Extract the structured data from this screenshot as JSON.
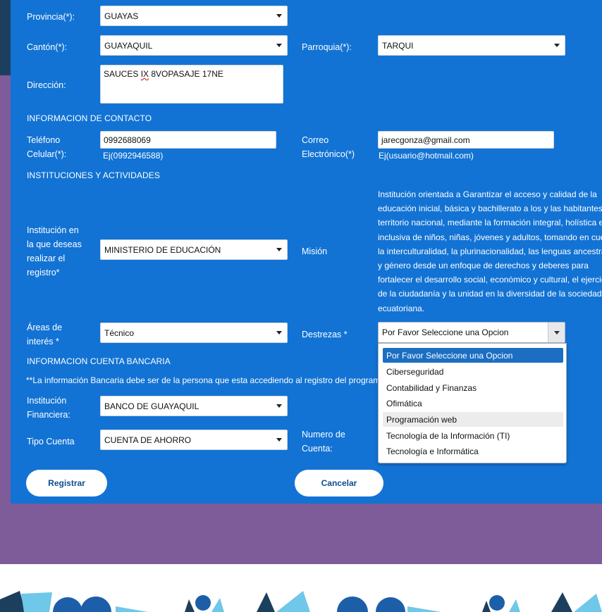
{
  "location": {
    "provincia_label": "Provincia(*):",
    "provincia_value": "GUAYAS",
    "canton_label": "Cantón(*):",
    "canton_value": "GUAYAQUIL",
    "parroquia_label": "Parroquia(*):",
    "parroquia_value": "TARQUI",
    "direccion_label": "Dirección:",
    "direccion_prefix": "SAUCES ",
    "direccion_misspelled": "IX",
    "direccion_suffix": " 8VOPASAJE 17NE"
  },
  "contact": {
    "section_title": "INFORMACION DE CONTACTO",
    "telefono_label_line1": "Teléfono",
    "telefono_label_line2": "Celular(*):",
    "telefono_value": "0992688069",
    "telefono_hint": "Ej(0992946588)",
    "correo_label_line1": "Correo",
    "correo_label_line2": "Electrónico(*)",
    "correo_value": "jarecgonza@gmail.com",
    "correo_hint": "Ej(usuario@hotmail.com)"
  },
  "institutions": {
    "section_title": "INSTITUCIONES Y ACTIVIDADES",
    "institucion_label_lines": [
      "Institución en",
      "la que deseas",
      "realizar el",
      "registro*"
    ],
    "institucion_value": "MINISTERIO DE EDUCACIÓN",
    "mision_label": "Misión",
    "mision_lines": [
      "Institución orientada a Garantizar el acceso y calidad de la",
      "educación inicial, básica y bachillerato a los y las habitantes del",
      "territorio nacional, mediante la formación integral, holística e",
      "inclusiva de niños, niñas, jóvenes y adultos, tomando en cuenta",
      "la interculturalidad, la plurinacionalidad, las lenguas ancestrales",
      "y género desde un enfoque de derechos y deberes para",
      "fortalecer el desarrollo social, económico y cultural, el ejercicio",
      "de la ciudadanía y la unidad en la diversidad de la sociedad",
      "ecuatoriana."
    ],
    "areas_label_line1": "Áreas de",
    "areas_label_line2": "interés *",
    "areas_value": "Técnico",
    "destrezas_label": "Destrezas *",
    "destrezas_value": "Por Favor Seleccione una Opcion",
    "destrezas_options": [
      "Por Favor Seleccione una Opcion",
      "Ciberseguridad",
      "Contabilidad y Finanzas",
      "Ofimática",
      "Programación web",
      "Tecnología de la Información (TI)",
      "Tecnología e Informática"
    ]
  },
  "bank": {
    "section_title": "INFORMACION CUENTA BANCARIA",
    "note": "**La información Bancaria debe ser de la persona que esta accediendo al registro del program",
    "institucion_label_line1": "Institución",
    "institucion_label_line2": "Financiera:",
    "institucion_value": "BANCO DE GUAYAQUIL",
    "tipo_label": "Tipo Cuenta",
    "tipo_value": "CUENTA DE AHORRO",
    "numero_label_line1": "Numero de",
    "numero_label_line2": "Cuenta:"
  },
  "actions": {
    "registrar_label": "Registrar",
    "cancelar_label": "Cancelar"
  },
  "colors": {
    "panel": "#1273d4",
    "page_purple": "#7e5b99",
    "header_navy": "#1c3f5e",
    "option_selected": "#1b6ec2"
  }
}
